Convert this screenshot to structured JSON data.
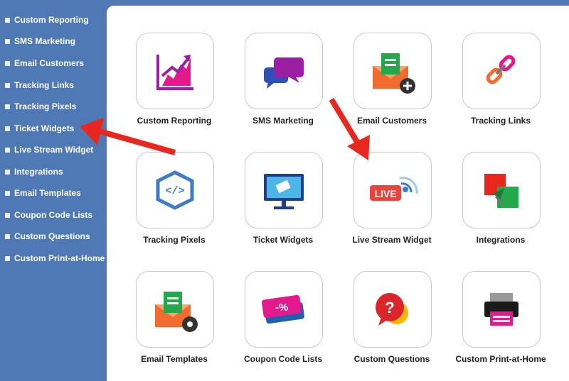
{
  "sidebar": {
    "items": [
      {
        "label": "Custom Reporting"
      },
      {
        "label": "SMS Marketing"
      },
      {
        "label": "Email Customers"
      },
      {
        "label": "Tracking Links"
      },
      {
        "label": "Tracking Pixels"
      },
      {
        "label": "Ticket Widgets"
      },
      {
        "label": "Live Stream Widget"
      },
      {
        "label": "Integrations"
      },
      {
        "label": "Email Templates"
      },
      {
        "label": "Coupon Code Lists"
      },
      {
        "label": "Custom Questions"
      },
      {
        "label": "Custom Print-at-Home"
      }
    ]
  },
  "grid": {
    "tiles": [
      {
        "label": "Custom Reporting",
        "icon": "chart-growth-icon"
      },
      {
        "label": "SMS Marketing",
        "icon": "chat-bubbles-icon"
      },
      {
        "label": "Email Customers",
        "icon": "envelope-add-icon"
      },
      {
        "label": "Tracking Links",
        "icon": "chain-link-icon"
      },
      {
        "label": "Tracking Pixels",
        "icon": "code-hexagon-icon"
      },
      {
        "label": "Ticket Widgets",
        "icon": "monitor-ticket-icon"
      },
      {
        "label": "Live Stream Widget",
        "icon": "live-broadcast-icon"
      },
      {
        "label": "Integrations",
        "icon": "integration-squares-icon"
      },
      {
        "label": "Email Templates",
        "icon": "envelope-gear-icon"
      },
      {
        "label": "Coupon Code Lists",
        "icon": "coupon-percent-icon"
      },
      {
        "label": "Custom Questions",
        "icon": "question-bubble-icon"
      },
      {
        "label": "Custom Print-at-Home",
        "icon": "printer-icon"
      }
    ]
  },
  "icon_text": {
    "live": "LIVE",
    "code": "</>",
    "percent": "-%",
    "question": "?"
  },
  "colors": {
    "sidebar_bg": "#4f79b5",
    "arrow": "#e8281e",
    "brand_purple": "#9a1fa3",
    "brand_pink": "#e4198d",
    "email_orange": "#f26a2e",
    "email_green": "#23a94b"
  }
}
